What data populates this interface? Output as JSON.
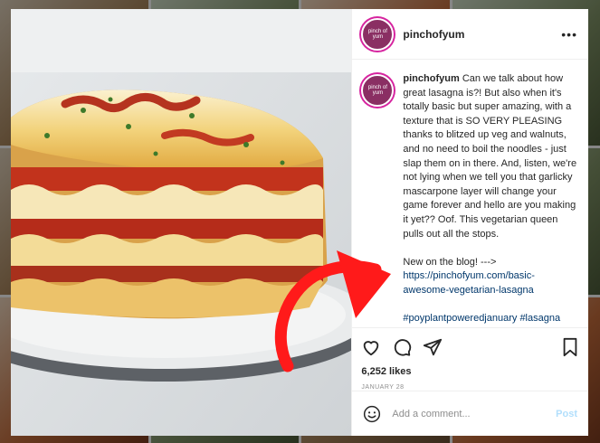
{
  "post": {
    "username": "pinchofyum",
    "avatar_text": "pinch of yum",
    "more_label": "•••",
    "caption_main": "Can we talk about how great lasagna is?! But also when it's totally basic but super amazing, with a texture that is SO VERY PLEASING thanks to blitzed up veg and walnuts, and no need to boil the noodles - just slap them on in there. And, listen, we're not lying when we tell you that garlicky mascarpone layer will change your game forever and hello are you making it yet?? Oof. This vegetarian queen pulls out all the stops.",
    "blog_prefix": "New on the blog! --->",
    "blog_link": "https://pinchofyum.com/basic-awesome-vegetarian-lasagna",
    "hashtags": "#poyplantpoweredjanuary #lasagna #pasta #vegetarian #veg #vegetarianfood #meatless",
    "likes": "6,252 likes",
    "date": "JANUARY 28"
  },
  "comment_box": {
    "placeholder": "Add a comment...",
    "post_label": "Post"
  },
  "icons": [
    "heart-icon",
    "comment-icon",
    "share-icon",
    "bookmark-icon",
    "emoji-icon",
    "more-icon"
  ],
  "colors": {
    "link": "#00376b",
    "arrow": "#ff1a1a",
    "post_button": "#b2dffc",
    "avatar_ring": "#d6249f"
  }
}
